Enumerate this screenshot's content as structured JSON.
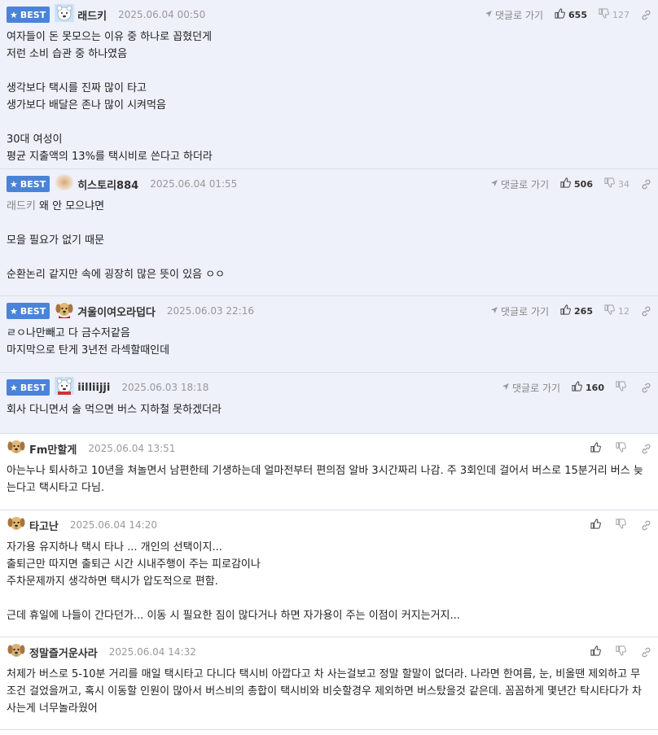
{
  "best_label": "BEST",
  "goto_label": "댓글로 가기",
  "comments": [
    {
      "best": true,
      "nick": "래드키",
      "date": "2025.06.04 00:50",
      "avatar": "bear",
      "up": "655",
      "down": "127",
      "mention": "",
      "text": "여자들이 돈 못모으는 이유 중 하나로 꼽혔던게\n저런 소비 습관 중 하나였음\n\n생각보다 택시를 진짜 많이 타고\n생가보다 배달은 존나 많이 시켜먹음\n\n30대 여성이\n평균 지출액의 13%를 택시비로 쓴다고 하더라"
    },
    {
      "best": true,
      "nick": "히스토리884",
      "date": "2025.06.04 01:55",
      "avatar": "blur",
      "up": "506",
      "down": "34",
      "mention": "래드키",
      "text": " 왜 안 모으냐면\n\n모을 필요가 없기 때문\n\n순환논리 같지만 속에 굉장히 많은 뜻이 있음 ㅇㅇ"
    },
    {
      "best": true,
      "nick": "겨울이여오라덥다",
      "date": "2025.06.03 22:16",
      "avatar": "dog-red",
      "up": "265",
      "down": "12",
      "mention": "",
      "text": "ㄹㅇ나만빼고 다 금수저같음\n마지막으로 탄게 3년전 라섹할때인데"
    },
    {
      "best": true,
      "nick": "iilliijji",
      "date": "2025.06.03 18:18",
      "avatar": "bear2",
      "up": "160",
      "down": "",
      "mention": "",
      "text": "회사 다니면서 술 먹으면 버스 지하철 못하겠더라"
    },
    {
      "best": false,
      "nick": "Fm만할게",
      "date": "2025.06.04 13:51",
      "avatar": "dog",
      "up": "",
      "down": "",
      "mention": "",
      "text": "아는누나 퇴사하고 10년을 쳐놀면서 남편한테 기생하는데 얼마전부터 편의점 알바 3시간짜리 나감. 주 3회인데 걸어서 버스로 15분거리 버스 늦는다고 택시타고 다님."
    },
    {
      "best": false,
      "nick": "타고난",
      "date": "2025.06.04 14:20",
      "avatar": "dog",
      "up": "",
      "down": "",
      "mention": "",
      "text": "자가용 유지하나 택시 타나 ... 개인의 선택이지...\n출퇴근만 따지면 출퇴근 시간 시내주행이 주는 피로감이나\n주차문제까지 생각하면 택시가 압도적으로 편함.\n\n근데 휴일에 나들이 간다던가... 이동 시 필요한 짐이 많다거나 하면 자가용이 주는 이점이 커지는거지..."
    },
    {
      "best": false,
      "nick": "정말즐거운사라",
      "date": "2025.06.04 14:32",
      "avatar": "dog2",
      "up": "",
      "down": "",
      "mention": "",
      "text": "처제가 버스로 5-10분 거리를 매일 택시타고 다니다 택시비 아깝다고 차 사는걸보고 정말 할말이 없더라. 나라면 한여름, 눈, 비올땐 제외하고 무조건 걸었을꺼고, 혹시 이동할 인원이 많아서 버스비의 총합이 택시비와 비슷할경우 제외하면 버스탔을것 같은데. 꼼꼼하게 몇년간 탁시타다가 차사는게 너무놀라웠어"
    }
  ]
}
